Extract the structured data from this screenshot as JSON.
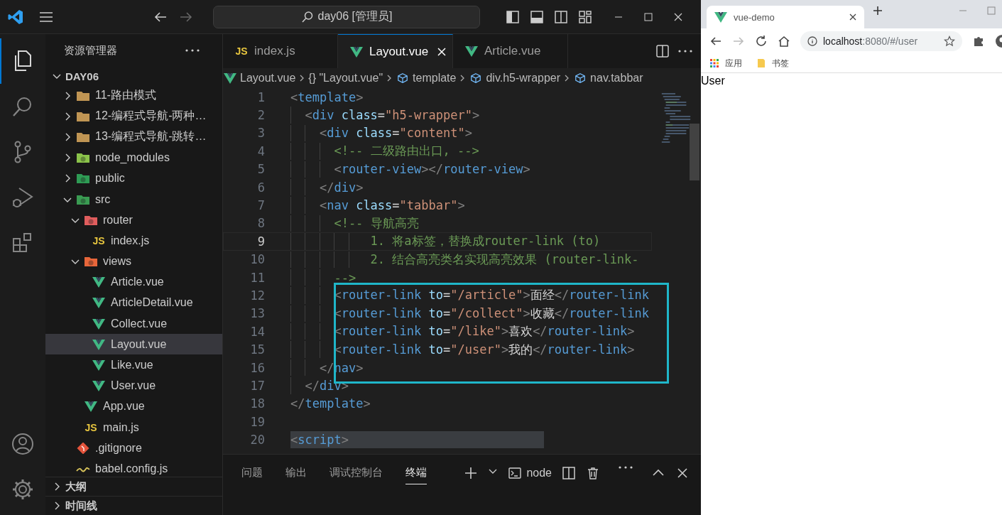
{
  "vscode": {
    "title_bar": {
      "search": "day06 [管理员]"
    },
    "activity_bar": [
      {
        "kind": "explorer",
        "selected": true
      },
      {
        "kind": "search",
        "selected": false
      },
      {
        "kind": "source-control",
        "selected": false
      },
      {
        "kind": "run",
        "selected": false
      },
      {
        "kind": "extensions",
        "selected": false
      }
    ],
    "activity_bar_bottom": [
      {
        "kind": "account"
      },
      {
        "kind": "settings"
      }
    ],
    "sidebar": {
      "title": "资源管理器",
      "section": {
        "title": "DAY06",
        "expanded": true
      },
      "tree": [
        {
          "name": "11-路由模式",
          "kind": "folder",
          "expanded": false,
          "selected": false
        },
        {
          "name": "12-编程式导航-两种…",
          "kind": "folder",
          "expanded": false,
          "selected": false
        },
        {
          "name": "13-编程式导航-跳转…",
          "kind": "folder",
          "expanded": false,
          "selected": false
        },
        {
          "name": "node_modules",
          "kind": "node-folder",
          "expanded": false,
          "selected": false
        },
        {
          "name": "public",
          "kind": "public-folder",
          "expanded": false,
          "selected": false
        },
        {
          "name": "src",
          "kind": "src-folder",
          "expanded": true,
          "selected": false,
          "children": [
            {
              "name": "router",
              "kind": "router-folder",
              "expanded": true,
              "selected": false,
              "children": [
                {
                  "name": "index.js",
                  "kind": "js",
                  "badge": "JS",
                  "selected": false
                }
              ]
            },
            {
              "name": "views",
              "kind": "views-folder",
              "expanded": true,
              "selected": false,
              "children": [
                {
                  "name": "Article.vue",
                  "kind": "vue",
                  "selected": false
                },
                {
                  "name": "ArticleDetail.vue",
                  "kind": "vue",
                  "selected": false
                },
                {
                  "name": "Collect.vue",
                  "kind": "vue",
                  "selected": false
                },
                {
                  "name": "Layout.vue",
                  "kind": "vue",
                  "selected": true
                },
                {
                  "name": "Like.vue",
                  "kind": "vue",
                  "selected": false
                },
                {
                  "name": "User.vue",
                  "kind": "vue",
                  "selected": false
                }
              ]
            },
            {
              "name": "App.vue",
              "kind": "vue",
              "selected": false
            },
            {
              "name": "main.js",
              "kind": "js",
              "badge": "JS",
              "selected": false
            }
          ]
        },
        {
          "name": ".gitignore",
          "kind": "git",
          "selected": false
        },
        {
          "name": "babel.config.js",
          "kind": "babel",
          "selected": false
        }
      ],
      "sections": [
        {
          "title": "大纲",
          "expanded": false
        },
        {
          "title": "时间线",
          "expanded": false
        }
      ]
    },
    "editor_tabs": [
      {
        "label": "index.js",
        "kind": "js",
        "badge": "JS",
        "selected": false
      },
      {
        "label": "Layout.vue",
        "kind": "vue",
        "selected": true
      },
      {
        "label": "Article.vue",
        "kind": "vue",
        "selected": false
      }
    ],
    "breadcrumbs": [
      {
        "kind": "vue",
        "text": "Layout.vue"
      },
      {
        "kind": "braces",
        "text": "{} \"Layout.vue\""
      },
      {
        "kind": "element",
        "text": "template"
      },
      {
        "kind": "element",
        "text": "div.h5-wrapper"
      },
      {
        "kind": "element",
        "text": "nav.tabbar"
      }
    ],
    "code_lines": [
      {
        "number": "1",
        "current": false,
        "selected": false,
        "tokens": [
          {
            "kind": "bracket",
            "text": "<"
          },
          {
            "kind": "tag",
            "text": "template"
          },
          {
            "kind": "bracket",
            "text": ">"
          }
        ]
      },
      {
        "number": "2",
        "current": false,
        "selected": false,
        "tokens": [
          {
            "kind": "bracket",
            "text": "  <"
          },
          {
            "kind": "tag",
            "text": "div"
          },
          {
            "kind": "attr",
            "text": " class"
          },
          {
            "kind": "text",
            "text": "="
          },
          {
            "kind": "string",
            "text": "\"h5-wrapper\""
          },
          {
            "kind": "bracket",
            "text": ">"
          }
        ]
      },
      {
        "number": "3",
        "current": false,
        "selected": false,
        "tokens": [
          {
            "kind": "bracket",
            "text": "    <"
          },
          {
            "kind": "tag",
            "text": "div"
          },
          {
            "kind": "attr",
            "text": " class"
          },
          {
            "kind": "text",
            "text": "="
          },
          {
            "kind": "string",
            "text": "\"content\""
          },
          {
            "kind": "bracket",
            "text": ">"
          }
        ]
      },
      {
        "number": "4",
        "current": false,
        "selected": false,
        "tokens": [
          {
            "kind": "comment",
            "text": "      <!-- 二级路由出口, -->"
          }
        ]
      },
      {
        "number": "5",
        "current": false,
        "selected": false,
        "tokens": [
          {
            "kind": "bracket",
            "text": "      <"
          },
          {
            "kind": "tag",
            "text": "router-view"
          },
          {
            "kind": "bracket",
            "text": "></"
          },
          {
            "kind": "tag",
            "text": "router-view"
          },
          {
            "kind": "bracket",
            "text": ">"
          }
        ]
      },
      {
        "number": "6",
        "current": false,
        "selected": false,
        "tokens": [
          {
            "kind": "bracket",
            "text": "    </"
          },
          {
            "kind": "tag",
            "text": "div"
          },
          {
            "kind": "bracket",
            "text": ">"
          }
        ]
      },
      {
        "number": "7",
        "current": false,
        "selected": false,
        "tokens": [
          {
            "kind": "bracket",
            "text": "    <"
          },
          {
            "kind": "tag",
            "text": "nav"
          },
          {
            "kind": "attr",
            "text": " class"
          },
          {
            "kind": "text",
            "text": "="
          },
          {
            "kind": "string",
            "text": "\"tabbar\""
          },
          {
            "kind": "bracket",
            "text": ">"
          }
        ]
      },
      {
        "number": "8",
        "current": false,
        "selected": false,
        "tokens": [
          {
            "kind": "comment",
            "text": "      <!-- 导航高亮"
          }
        ]
      },
      {
        "number": "9",
        "current": true,
        "selected": false,
        "tokens": [
          {
            "kind": "comment",
            "text": "           1. 将a标签，替换成router-link (to)"
          }
        ]
      },
      {
        "number": "10",
        "current": false,
        "selected": false,
        "tokens": [
          {
            "kind": "comment",
            "text": "           2. 结合高亮类名实现高亮效果 (router-link-"
          }
        ]
      },
      {
        "number": "11",
        "current": false,
        "selected": false,
        "tokens": [
          {
            "kind": "comment",
            "text": "      -->"
          }
        ]
      },
      {
        "number": "12",
        "current": false,
        "selected": false,
        "tokens": [
          {
            "kind": "bracket",
            "text": "      <"
          },
          {
            "kind": "tag",
            "text": "router-link"
          },
          {
            "kind": "attr",
            "text": " to"
          },
          {
            "kind": "text",
            "text": "="
          },
          {
            "kind": "string",
            "text": "\"/article\""
          },
          {
            "kind": "bracket",
            "text": ">"
          },
          {
            "kind": "text",
            "text": "面经"
          },
          {
            "kind": "bracket",
            "text": "</"
          },
          {
            "kind": "tag",
            "text": "router-link"
          }
        ]
      },
      {
        "number": "13",
        "current": false,
        "selected": false,
        "tokens": [
          {
            "kind": "bracket",
            "text": "      <"
          },
          {
            "kind": "tag",
            "text": "router-link"
          },
          {
            "kind": "attr",
            "text": " to"
          },
          {
            "kind": "text",
            "text": "="
          },
          {
            "kind": "string",
            "text": "\"/collect\""
          },
          {
            "kind": "bracket",
            "text": ">"
          },
          {
            "kind": "text",
            "text": "收藏"
          },
          {
            "kind": "bracket",
            "text": "</"
          },
          {
            "kind": "tag",
            "text": "router-link"
          }
        ]
      },
      {
        "number": "14",
        "current": false,
        "selected": false,
        "tokens": [
          {
            "kind": "bracket",
            "text": "      <"
          },
          {
            "kind": "tag",
            "text": "router-link"
          },
          {
            "kind": "attr",
            "text": " to"
          },
          {
            "kind": "text",
            "text": "="
          },
          {
            "kind": "string",
            "text": "\"/like\""
          },
          {
            "kind": "bracket",
            "text": ">"
          },
          {
            "kind": "text",
            "text": "喜欢"
          },
          {
            "kind": "bracket",
            "text": "</"
          },
          {
            "kind": "tag",
            "text": "router-link"
          },
          {
            "kind": "bracket",
            "text": ">"
          }
        ]
      },
      {
        "number": "15",
        "current": false,
        "selected": false,
        "tokens": [
          {
            "kind": "bracket",
            "text": "      <"
          },
          {
            "kind": "tag",
            "text": "router-link"
          },
          {
            "kind": "attr",
            "text": " to"
          },
          {
            "kind": "text",
            "text": "="
          },
          {
            "kind": "string",
            "text": "\"/user\""
          },
          {
            "kind": "bracket",
            "text": ">"
          },
          {
            "kind": "text",
            "text": "我的"
          },
          {
            "kind": "bracket",
            "text": "</"
          },
          {
            "kind": "tag",
            "text": "router-link"
          },
          {
            "kind": "bracket",
            "text": ">"
          }
        ]
      },
      {
        "number": "16",
        "current": false,
        "selected": false,
        "tokens": [
          {
            "kind": "bracket",
            "text": "    </"
          },
          {
            "kind": "tag",
            "text": "nav"
          },
          {
            "kind": "bracket",
            "text": ">"
          }
        ]
      },
      {
        "number": "17",
        "current": false,
        "selected": false,
        "tokens": [
          {
            "kind": "bracket",
            "text": "  </"
          },
          {
            "kind": "tag",
            "text": "div"
          },
          {
            "kind": "bracket",
            "text": ">"
          }
        ]
      },
      {
        "number": "18",
        "current": false,
        "selected": false,
        "tokens": [
          {
            "kind": "bracket",
            "text": "</"
          },
          {
            "kind": "tag",
            "text": "template"
          },
          {
            "kind": "bracket",
            "text": ">"
          }
        ]
      },
      {
        "number": "19",
        "current": false,
        "selected": false
      },
      {
        "number": "20",
        "current": false,
        "selected": true,
        "tokens": [
          {
            "kind": "bracket",
            "text": "<"
          },
          {
            "kind": "tag",
            "text": "script"
          },
          {
            "kind": "bracket",
            "text": ">"
          }
        ]
      }
    ],
    "panel": {
      "tabs": [
        {
          "label": "问题",
          "selected": false
        },
        {
          "label": "输出",
          "selected": false
        },
        {
          "label": "调试控制台",
          "selected": false
        },
        {
          "label": "终端",
          "selected": true
        }
      ],
      "terminal": "node"
    }
  },
  "browser": {
    "tab": {
      "title": "vue-demo"
    },
    "address": {
      "host": "localhost",
      "rest": ":8080/#/user"
    },
    "back_enabled": true,
    "forward_enabled": false,
    "bookmarks": [
      {
        "kind": "apps",
        "label": "应用"
      },
      {
        "kind": "folder",
        "label": "书签"
      }
    ],
    "page_text": "User"
  }
}
